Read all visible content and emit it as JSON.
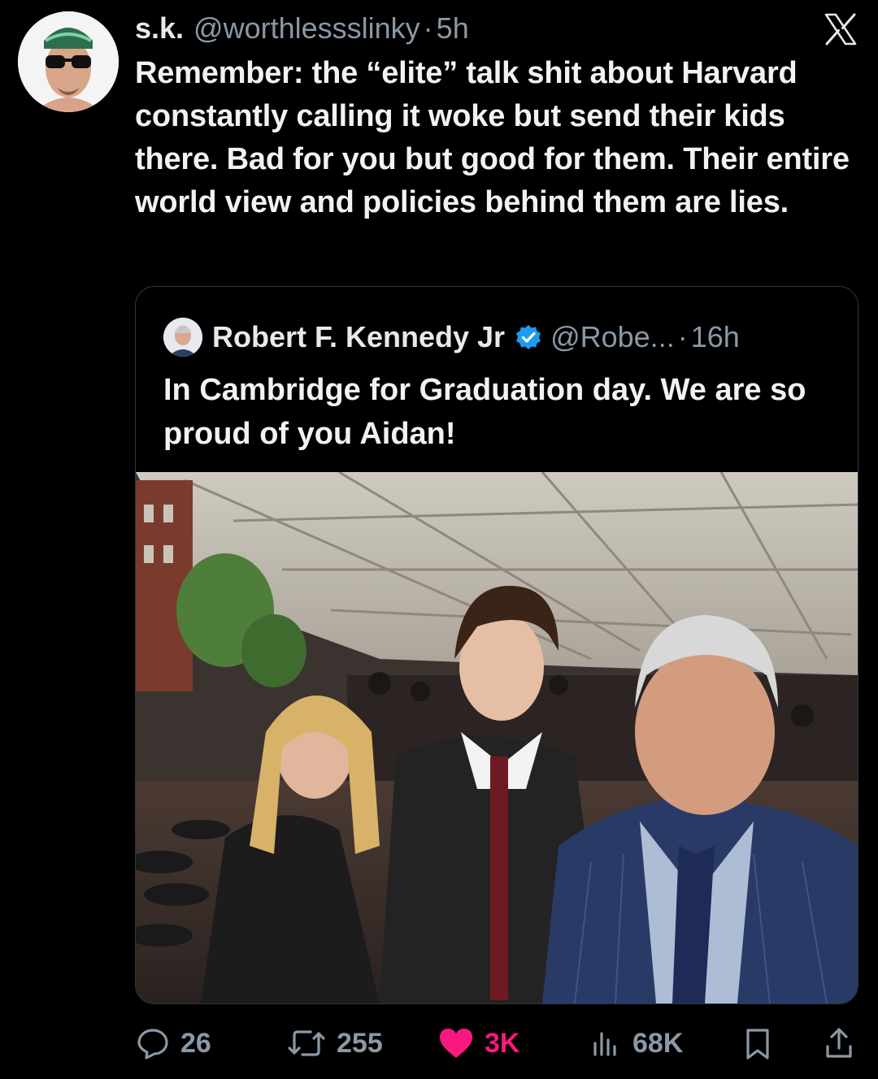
{
  "tweet": {
    "display_name": "s.k.",
    "handle": "@worthlessslinky",
    "separator": "·",
    "time": "5h",
    "text": "Remember: the “elite” talk shit about Harvard constantly calling it woke but send their kids there. Bad for you but good for them. Their entire world view and policies behind them are lies."
  },
  "quoted_tweet": {
    "display_name": "Robert F. Kennedy Jr",
    "handle": "@Robe...",
    "separator": "·",
    "time": "16h",
    "text": "In Cambridge for Graduation day. We are so proud of you Aidan!"
  },
  "actions": {
    "replies": "26",
    "reposts": "255",
    "likes": "3K",
    "views": "68K"
  },
  "icons": [
    "x-logo-icon",
    "verified-badge-icon",
    "reply-icon",
    "repost-icon",
    "heart-icon",
    "views-icon",
    "bookmark-icon",
    "share-icon"
  ],
  "colors": {
    "like_active": "#f91880",
    "verified": "#1d9bf0",
    "muted": "#8b98a5"
  }
}
